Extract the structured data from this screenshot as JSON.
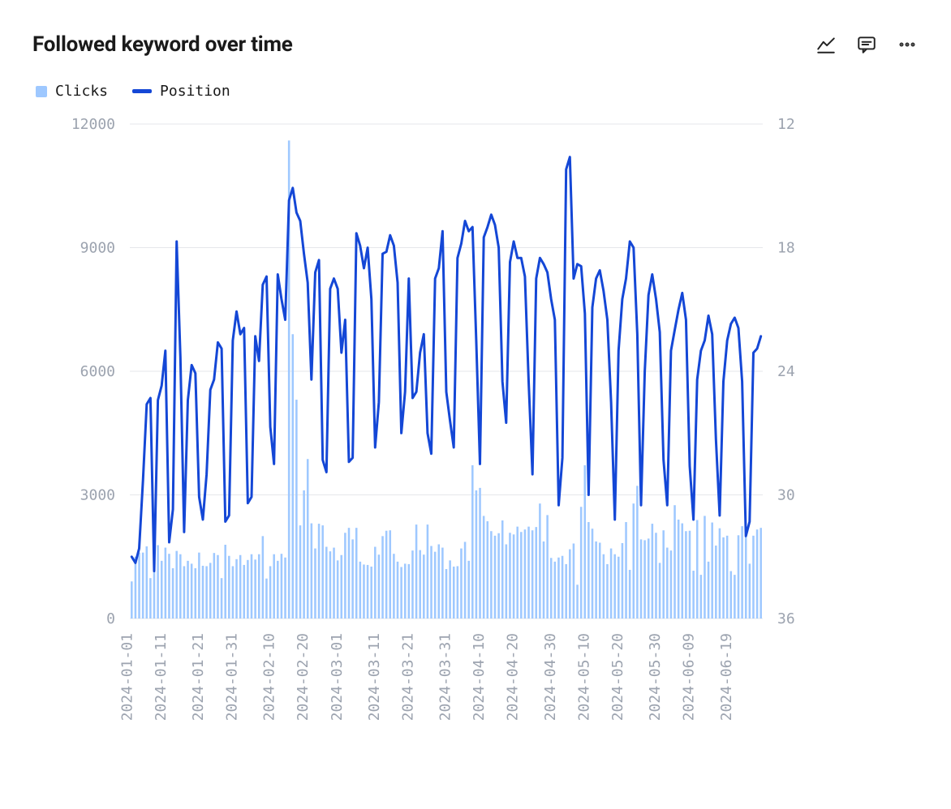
{
  "header": {
    "title": "Followed keyword over time",
    "icons": {
      "line_chart": "line-chart-icon",
      "comment": "comment-icon",
      "more": "more-icon"
    }
  },
  "legend": {
    "clicks": "Clicks",
    "position": "Position"
  },
  "chart_data": {
    "type": "bar+line",
    "title": "Followed keyword over time",
    "xlabel": "",
    "y_left_label": "",
    "y_right_label": "",
    "y_left_ticks": [
      0,
      3000,
      6000,
      9000,
      12000
    ],
    "y_right_ticks": [
      12,
      18,
      24,
      30,
      36
    ],
    "y_left_range": [
      0,
      12000
    ],
    "y_right_range": [
      36,
      12
    ],
    "x_tick_labels": [
      "2024-01-01",
      "2024-01-11",
      "2024-01-21",
      "2024-01-31",
      "2024-02-10",
      "2024-02-20",
      "2024-03-01",
      "2024-03-11",
      "2024-03-21",
      "2024-03-31",
      "2024-04-10",
      "2024-04-20",
      "2024-04-30",
      "2024-05-10",
      "2024-05-20",
      "2024-05-30",
      "2024-06-09",
      "2024-06-19"
    ],
    "series": [
      {
        "name": "Clicks",
        "kind": "bar",
        "axis": "left",
        "color": "#9ec8ff",
        "values": [
          900,
          1500,
          1600,
          1600,
          1750,
          980,
          1470,
          1780,
          1400,
          1720,
          1570,
          1220,
          1640,
          1560,
          1270,
          1400,
          1330,
          1220,
          1600,
          1280,
          1270,
          1350,
          1590,
          1540,
          980,
          1790,
          1520,
          1270,
          1440,
          1540,
          1300,
          1420,
          1560,
          1430,
          1560,
          2000,
          970,
          1270,
          1560,
          1400,
          1570,
          1480,
          11600,
          6900,
          5310,
          2260,
          3110,
          3870,
          2310,
          1700,
          2300,
          2260,
          1740,
          1630,
          1720,
          1410,
          1540,
          2080,
          2200,
          1920,
          2200,
          1380,
          1310,
          1300,
          1260,
          1740,
          1550,
          2000,
          2130,
          2140,
          1570,
          1380,
          1250,
          1330,
          1320,
          1650,
          2280,
          1660,
          1550,
          2280,
          1760,
          1620,
          1800,
          1720,
          1200,
          1410,
          1260,
          1270,
          1700,
          1860,
          1400,
          3720,
          3110,
          3170,
          2490,
          2360,
          2120,
          2010,
          2070,
          2380,
          1800,
          2080,
          2040,
          2230,
          2100,
          2160,
          2230,
          2140,
          2220,
          2790,
          1870,
          2510,
          1470,
          1380,
          1480,
          1520,
          1320,
          1680,
          1820,
          820,
          2710,
          3720,
          2340,
          2180,
          1870,
          1840,
          1560,
          1320,
          1700,
          1560,
          1500,
          1830,
          2340,
          1180,
          2790,
          3220,
          1920,
          1900,
          1940,
          2300,
          2080,
          1350,
          2140,
          1720,
          1650,
          2750,
          2400,
          2310,
          2120,
          2130,
          1160,
          2390,
          1060,
          2490,
          1380,
          2330,
          1770,
          2190,
          1970,
          2010,
          1150,
          1060,
          2020,
          2240,
          2230,
          1330,
          2010,
          2160,
          2200
        ]
      },
      {
        "name": "Position",
        "kind": "line",
        "axis": "right",
        "color": "#1447d6",
        "values": [
          33.0,
          33.3,
          32.6,
          29.3,
          25.6,
          25.3,
          33.7,
          25.4,
          24.7,
          23.0,
          32.3,
          30.7,
          17.7,
          23.3,
          31.8,
          25.4,
          23.7,
          24.1,
          30.1,
          31.2,
          29.0,
          24.9,
          24.4,
          22.6,
          22.9,
          31.3,
          31.0,
          22.5,
          21.1,
          22.2,
          21.9,
          30.4,
          30.1,
          22.3,
          23.5,
          19.8,
          19.4,
          26.7,
          28.5,
          19.3,
          20.5,
          21.5,
          15.7,
          15.1,
          16.3,
          16.7,
          18.3,
          19.7,
          24.4,
          19.2,
          18.6,
          28.3,
          28.9,
          20.0,
          19.5,
          20.0,
          23.1,
          21.5,
          28.4,
          28.2,
          17.3,
          17.9,
          19.0,
          18.0,
          20.5,
          27.7,
          25.5,
          18.3,
          18.2,
          17.4,
          17.9,
          19.7,
          27.0,
          25.0,
          19.5,
          25.3,
          25.0,
          23.1,
          22.2,
          27.0,
          28.0,
          19.5,
          19.0,
          17.2,
          25.0,
          26.4,
          27.7,
          18.5,
          17.8,
          16.7,
          17.2,
          17.0,
          22.5,
          28.5,
          17.5,
          17.0,
          16.4,
          16.9,
          18.0,
          24.5,
          26.5,
          18.7,
          17.7,
          18.5,
          18.5,
          19.4,
          24.5,
          29.0,
          19.5,
          18.5,
          18.8,
          19.2,
          20.5,
          21.5,
          30.5,
          28.2,
          14.2,
          13.6,
          19.5,
          18.8,
          18.9,
          21.2,
          30.0,
          20.9,
          19.5,
          19.1,
          20.1,
          21.5,
          25.5,
          31.2,
          23.0,
          20.5,
          19.5,
          17.7,
          18.0,
          22.2,
          30.5,
          24.0,
          20.3,
          19.3,
          20.5,
          22.1,
          28.3,
          30.5,
          23.0,
          22.0,
          21.0,
          20.2,
          21.5,
          28.6,
          31.2,
          24.4,
          23.0,
          22.5,
          21.3,
          22.2,
          27.3,
          31.0,
          24.5,
          22.5,
          21.7,
          21.4,
          21.9,
          24.5,
          32.0,
          31.3,
          23.1,
          22.9,
          22.3
        ]
      }
    ]
  }
}
